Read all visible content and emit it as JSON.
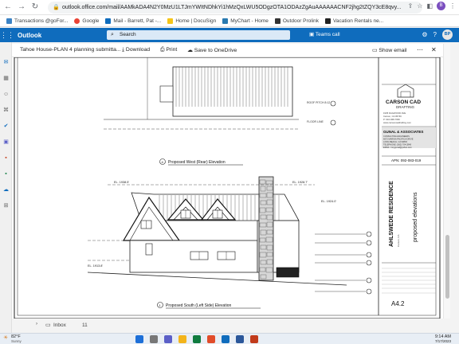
{
  "browser": {
    "url": "outlook.office.com/mail/AAMkADA4N2Y0MzU1LTJmYWItNDhkYi1hMzQxLWU5ODgzOTA1ODAzZgAuAAAAAACNF2jhg2tZQY3cE8qvy..."
  },
  "bookmarks": [
    {
      "label": "Transactions @goFor...",
      "color": "#3b82c4"
    },
    {
      "label": "Google",
      "color": "#ea4335"
    },
    {
      "label": "Mail - Barrett, Pat -...",
      "color": "#0f6cbd"
    },
    {
      "label": "Home | DocuSign",
      "color": "#f5c518"
    },
    {
      "label": "MyChart - Home",
      "color": "#2a7ab0"
    },
    {
      "label": "Outdoor Prolink",
      "color": "#333333"
    },
    {
      "label": "Vacation Rentals ne...",
      "color": "#222222"
    }
  ],
  "outlook": {
    "app_name": "Outlook",
    "search_placeholder": "Search",
    "teams_label": "Teams call",
    "avatar_initials": "BP"
  },
  "viewer": {
    "filename": "Tahoe House-PLAN 4 planning submitta...",
    "download": "Download",
    "print": "Print",
    "save": "Save to OneDrive",
    "show_email": "Show email"
  },
  "drawing": {
    "west_label": "Proposed West (Rear) Elevation",
    "west_num": "4",
    "south_label": "Proposed South (Left Side) Elevation",
    "south_num": "1",
    "firm": "CARSON CAD",
    "firm_sub": "DRAFTING",
    "firm_address": "1935 DAGWOOD AVE.\nCarson, CA 95746\nP: 916-968-7960\nwww.carsoncaddrafting.com",
    "engineer": "GUNAL & ASSOCIATES",
    "engineer_info": "CONSULTING ENGINEERS\n6672 MARINA PACIFICA DRIVE\nLONG BEACH, CA 90803\nTELEPHONE: (562) 704-2848\nEMAIL: mnygunal@yahoo.com",
    "apn": "APN: 092-083-019",
    "project": "AHLSWEDE RESIDENCE",
    "sheet_title": "proposed elevations",
    "sheet_no": "A4.2",
    "el_top": "EL. 1938.5'",
    "el_ridge": "EL. 1928.7'",
    "el_mid": "EL. 1924.0'",
    "el_low": "EL. 1913.8'"
  },
  "below": {
    "inbox": "Inbox",
    "count": "11"
  },
  "taskbar": {
    "weather_temp": "82°F",
    "weather_desc": "Sunny",
    "time": "9:14 AM",
    "date": "7/17/2023"
  }
}
